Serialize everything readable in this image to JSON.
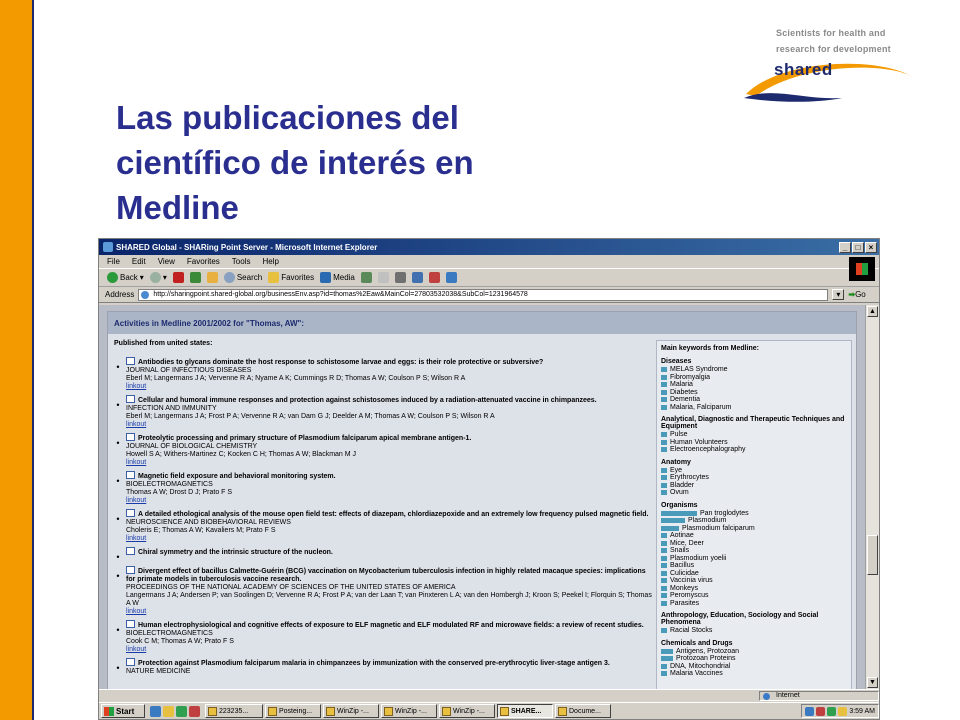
{
  "slide": {
    "title_lines": [
      "Las publicaciones del",
      "científico de interés en",
      "Medline"
    ]
  },
  "logo": {
    "tagline1": "Scientists for health and",
    "tagline2": "research for development",
    "word": "shared"
  },
  "window": {
    "title": "SHARED Global - SHARing Point Server - Microsoft Internet Explorer",
    "buttons": [
      "_",
      "□",
      "×"
    ]
  },
  "menu": [
    "File",
    "Edit",
    "View",
    "Favorites",
    "Tools",
    "Help"
  ],
  "toolbar": {
    "back": "Back",
    "search": "Search",
    "favorites": "Favorites",
    "media": "Media"
  },
  "address": {
    "label": "Address",
    "url": "http://sharingpoint.shared-global.org/businessEnv.asp?id=thomas%2Eaw&MainCol=27803532038&SubCol=1231964578",
    "go": "Go"
  },
  "page": {
    "heading": "Activities in Medline 2001/2002 for \"Thomas, AW\":",
    "published_from": "Published from united states:",
    "linkout": "linkout",
    "publications": [
      {
        "title": "Antibodies to glycans dominate the host response to schistosome larvae and eggs: is their role protective or subversive?",
        "journal": "JOURNAL OF INFECTIOUS DISEASES",
        "authors": "Eberl M; Langermans J A; Vervenne R A; Nyame A K; Cummings R D; Thomas A W; Coulson P S; Wilson R A"
      },
      {
        "title": "Cellular and humoral immune responses and protection against schistosomes induced by a radiation-attenuated vaccine in chimpanzees.",
        "journal": "INFECTION AND IMMUNITY",
        "authors": "Eberl M; Langermans J A; Frost P A; Vervenne R A; van Dam G J; Deelder A M; Thomas A W; Coulson P S; Wilson R A"
      },
      {
        "title": "Proteolytic processing and primary structure of Plasmodium falciparum apical membrane antigen-1.",
        "journal": "JOURNAL OF BIOLOGICAL CHEMISTRY",
        "authors": "Howell S A; Withers-Martinez C; Kocken C H; Thomas A W; Blackman M J"
      },
      {
        "title": "Magnetic field exposure and behavioral monitoring system.",
        "journal": "BIOELECTROMAGNETICS",
        "authors": "Thomas A W; Drost D J; Prato F S"
      },
      {
        "title": "A detailed ethological analysis of the mouse open field test: effects of diazepam, chlordiazepoxide and an extremely low frequency pulsed magnetic field.",
        "journal": "NEUROSCIENCE AND BIOBEHAVIORAL REVIEWS",
        "authors": "Choleris E; Thomas A W; Kavaliers M; Prato F S"
      },
      {
        "title": "Chiral symmetry and the intrinsic structure of the nucleon.",
        "journal": "",
        "authors": ""
      },
      {
        "title": "Divergent effect of bacillus Calmette-Guérin (BCG) vaccination on Mycobacterium tuberculosis infection in highly related macaque species: implications for primate models in tuberculosis vaccine research.",
        "journal": "PROCEEDINGS OF THE NATIONAL ACADEMY OF SCIENCES OF THE UNITED STATES OF AMERICA",
        "authors": "Langermans J A; Andersen P; van Soolingen D; Vervenne R A; Frost P A; van der Laan T; van Pinxteren L A; van den Hombergh J; Kroon S; Peekel I; Florquin S; Thomas A W"
      },
      {
        "title": "Human electrophysiological and cognitive effects of exposure to ELF magnetic and ELF modulated RF and microwave fields: a review of recent studies.",
        "journal": "BIOELECTROMAGNETICS",
        "authors": "Cook C M; Thomas A W; Prato F S"
      },
      {
        "title": "Protection against Plasmodium falciparum malaria in chimpanzees by immunization with the conserved pre-erythrocytic liver-stage antigen 3.",
        "journal": "NATURE MEDICINE",
        "authors": ""
      }
    ]
  },
  "keywords": {
    "heading": "Main keywords from Medline:",
    "sections": [
      {
        "name": "Diseases",
        "items": [
          {
            "label": "MELAS Syndrome",
            "weight": 1
          },
          {
            "label": "Fibromyalgia",
            "weight": 1
          },
          {
            "label": "Malaria",
            "weight": 1
          },
          {
            "label": "Diabetes",
            "weight": 1
          },
          {
            "label": "Dementia",
            "weight": 1
          },
          {
            "label": "Malaria, Falciparum",
            "weight": 1
          }
        ]
      },
      {
        "name": "Analytical, Diagnostic and Therapeutic Techniques and Equipment",
        "items": [
          {
            "label": "Pulse",
            "weight": 1
          },
          {
            "label": "Human Volunteers",
            "weight": 1
          },
          {
            "label": "Electroencephalography",
            "weight": 1
          }
        ]
      },
      {
        "name": "Anatomy",
        "items": [
          {
            "label": "Eye",
            "weight": 1
          },
          {
            "label": "Erythrocytes",
            "weight": 1
          },
          {
            "label": "Bladder",
            "weight": 1
          },
          {
            "label": "Ovum",
            "weight": 1
          }
        ]
      },
      {
        "name": "Organisms",
        "items": [
          {
            "label": "Pan troglodytes",
            "weight": 6
          },
          {
            "label": "Plasmodium",
            "weight": 4
          },
          {
            "label": "Plasmodium falciparum",
            "weight": 3
          },
          {
            "label": "Aotinae",
            "weight": 1
          },
          {
            "label": "Mice, Deer",
            "weight": 1
          },
          {
            "label": "Snails",
            "weight": 1
          },
          {
            "label": "Plasmodium yoelii",
            "weight": 1
          },
          {
            "label": "Bacillus",
            "weight": 1
          },
          {
            "label": "Culicidae",
            "weight": 1
          },
          {
            "label": "Vaccinia virus",
            "weight": 1
          },
          {
            "label": "Monkeys",
            "weight": 1
          },
          {
            "label": "Peromyscus",
            "weight": 1
          },
          {
            "label": "Parasites",
            "weight": 1
          }
        ]
      },
      {
        "name": "Anthropology, Education, Sociology and Social Phenomena",
        "items": [
          {
            "label": "Racial Stocks",
            "weight": 1
          }
        ]
      },
      {
        "name": "Chemicals and Drugs",
        "items": [
          {
            "label": "Antigens, Protozoan",
            "weight": 2
          },
          {
            "label": "Protozoan Proteins",
            "weight": 2
          },
          {
            "label": "DNA, Mitochondrial",
            "weight": 1
          },
          {
            "label": "Malaria Vaccines",
            "weight": 1
          }
        ]
      }
    ]
  },
  "status": {
    "zone": "Internet"
  },
  "taskbar": {
    "start": "Start",
    "tasks": [
      {
        "label": "223235...",
        "active": false
      },
      {
        "label": "Posteing...",
        "active": false
      },
      {
        "label": "WinZip -...",
        "active": false
      },
      {
        "label": "WinZip -...",
        "active": false
      },
      {
        "label": "WinZip -...",
        "active": false
      },
      {
        "label": "SHARE...",
        "active": true
      },
      {
        "label": "Docume...",
        "active": false
      }
    ],
    "clock": "3:59 AM"
  },
  "colors": {
    "accent_orange": "#f39a00",
    "title_blue": "#2a2f8f",
    "brand_navy": "#1e2a6e",
    "keyword_bar": "#4a9aba"
  }
}
